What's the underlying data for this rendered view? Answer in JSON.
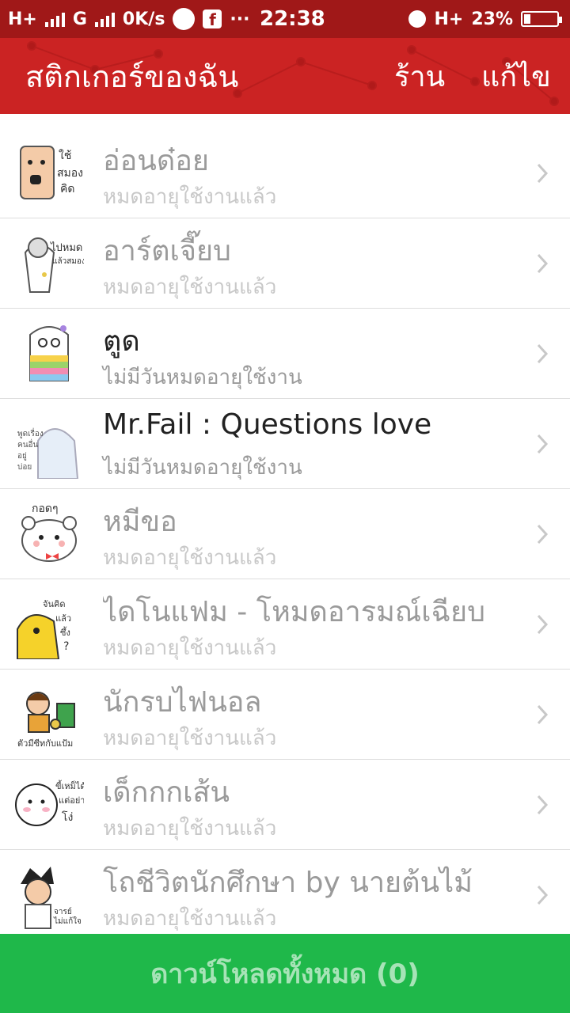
{
  "status_bar": {
    "network1": "H+",
    "network2": "G",
    "speed": "0K/s",
    "dots": "···",
    "time": "22:38",
    "network3": "H+",
    "battery": "23%"
  },
  "header": {
    "title": "สติกเกอร์ของฉัน",
    "shop_label": "ร้าน",
    "edit_label": "แก้ไข"
  },
  "stickers": [
    {
      "name": "อ่อนด๋อย",
      "status": "หมดอายุใช้งานแล้ว",
      "active": false
    },
    {
      "name": "อาร์ตเจี๊ยบ",
      "status": "หมดอายุใช้งานแล้ว",
      "active": false
    },
    {
      "name": "ตูด",
      "status": "ไม่มีวันหมดอายุใช้งาน",
      "active": true
    },
    {
      "name": "Mr.Fail : Questions love",
      "status": "ไม่มีวันหมดอายุใช้งาน",
      "active": true
    },
    {
      "name": "หมีขอ",
      "status": "หมดอายุใช้งานแล้ว",
      "active": false
    },
    {
      "name": "ไดโนแฟม - โหมดอารมณ์เฉียบ",
      "status": "หมดอายุใช้งานแล้ว",
      "active": false
    },
    {
      "name": "นักรบไฟนอล",
      "status": "หมดอายุใช้งานแล้ว",
      "active": false
    },
    {
      "name": "เด็กกกเส้น",
      "status": "หมดอายุใช้งานแล้ว",
      "active": false
    },
    {
      "name": "โถชีวิตนักศึกษา by  นายต้นไม้",
      "status": "หมดอายุใช้งานแล้ว",
      "active": false
    }
  ],
  "footer": {
    "download_all_label": "ดาวน์โหลดทั้งหมด (0)"
  },
  "colors": {
    "status_bar": "#a01818",
    "header": "#cb2323",
    "download_bar": "#1fb84a"
  }
}
